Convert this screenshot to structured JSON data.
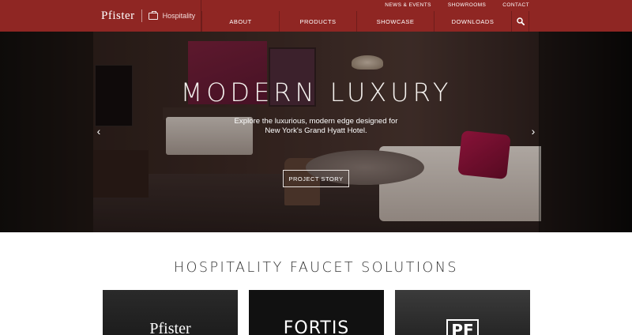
{
  "header": {
    "brand": "Pfister",
    "brand_sub": "Hospitality",
    "brand_icon": "briefcase-icon",
    "utility_links": [
      "NEWS & EVENTS",
      "SHOWROOMS",
      "CONTACT"
    ],
    "nav_items": [
      "ABOUT",
      "PRODUCTS",
      "SHOWCASE",
      "DOWNLOADS"
    ],
    "search_icon": "search-icon",
    "color": "#8f2623"
  },
  "hero": {
    "title": "MODERN LUXURY",
    "description": "Explore the luxurious, modern edge designed for New York's Grand Hyatt Hotel.",
    "button_label": "PROJECT STORY",
    "prev_icon": "‹",
    "next_icon": "›"
  },
  "section": {
    "title": "HOSPITALITY FAUCET SOLUTIONS",
    "cards": [
      "Pfister",
      "FORTIS",
      "PF"
    ]
  }
}
